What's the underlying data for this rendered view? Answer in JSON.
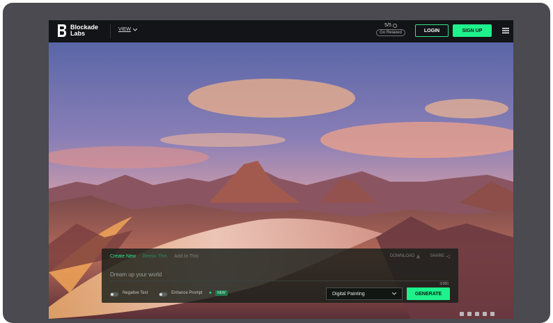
{
  "app": {
    "brand_line1": "Blockade",
    "brand_line2": "Labs"
  },
  "header": {
    "view_label": "VIEW",
    "credits": "5/5",
    "mode_badge": "Go Relaxed",
    "login_label": "LOGIN",
    "signup_label": "SIGN UP"
  },
  "panel": {
    "tabs": [
      {
        "label": "Create New"
      },
      {
        "label": "Remix This"
      },
      {
        "label": "Add to This"
      }
    ],
    "actions": [
      {
        "label": "DOWNLOAD"
      },
      {
        "label": "SHARE"
      }
    ],
    "prompt_placeholder": "Dream up your world",
    "char_count": "0/380",
    "negative_text_label": "Negative Text",
    "enhance_prompt_label": "Enhance Prompt",
    "new_badge": "NEW",
    "style_value": "Digital Painting",
    "generate_label": "GENERATE"
  },
  "colors": {
    "accent": "#1ff28c",
    "topbar": "#121417",
    "frame": "#4a4a50"
  },
  "icons": [
    "menu-icon",
    "chevron-down-icon",
    "info-icon",
    "download-icon",
    "share-icon",
    "sparkle-icon",
    "twitter-icon",
    "instagram-icon",
    "discord-icon",
    "youtube-icon",
    "linkedin-icon"
  ]
}
